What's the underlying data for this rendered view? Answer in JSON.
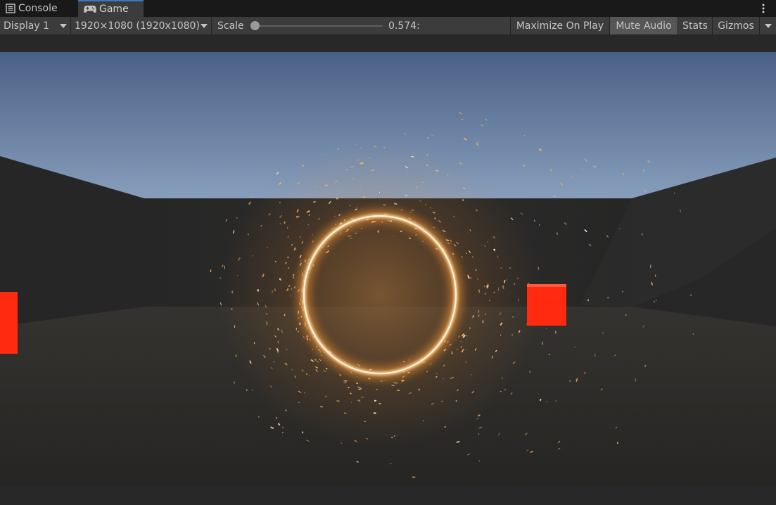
{
  "tabs": {
    "console": {
      "label": "Console",
      "icon": "console-list-icon"
    },
    "game": {
      "label": "Game",
      "icon": "gamepad-icon",
      "active": true
    }
  },
  "menu": {
    "icon": "kebab-menu-icon"
  },
  "toolbar": {
    "display": "Display 1",
    "resolution": "1920×1080 (1920x1080)",
    "scale_label": "Scale",
    "scale_value": "0.574:",
    "scale_fraction": 0.0,
    "maximize_on_play": "Maximize On Play",
    "mute_audio": "Mute Audio",
    "mute_audio_active": true,
    "stats": "Stats",
    "gizmos": "Gizmos"
  },
  "scene": {
    "sky_top": "#4d6488",
    "sky_horizon": "#8ca3c0",
    "wall": "#2b2b2b",
    "floor": "#2e2d2c",
    "ring_color": "#ffcf8a",
    "spark_color": "#ffb35c",
    "cube_color": "#ff2a10"
  }
}
